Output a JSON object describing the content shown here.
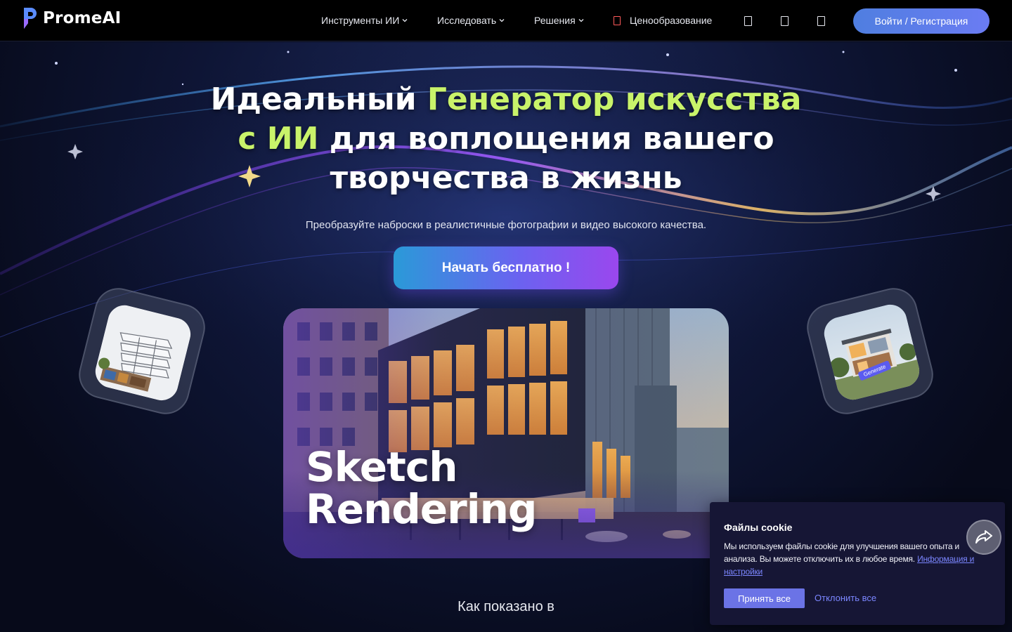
{
  "header": {
    "logo_text": "PromeAI",
    "nav": [
      {
        "label": "Инструменты ИИ"
      },
      {
        "label": "Исследовать"
      },
      {
        "label": "Решения"
      },
      {
        "label": "Ценообразование"
      }
    ],
    "icons": [
      "square-icon",
      "square-icon",
      "square-icon"
    ],
    "login_label": "Войти / Регистрация"
  },
  "hero": {
    "headline_part1": "Идеальный ",
    "headline_accent1": "Генератор искусства",
    "headline_accent2": "с ИИ",
    "headline_part2": " для воплощения вашего",
    "headline_part3": "творчества в жизнь",
    "subtitle": "Преобразуйте наброски в реалистичные фотографии и видео высокого качества.",
    "cta_label": "Начать бесплатно !",
    "main_caption_line1": "Sketch",
    "main_caption_line2": "Rendering",
    "tile_right_badge": "Generate",
    "as_seen": "Как показано в"
  },
  "cookie": {
    "title": "Файлы cookie",
    "text": "Мы используем файлы cookie для улучшения вашего опыта и анализа. Вы можете отключить их в любое время. ",
    "link": "Информация и настройки",
    "accept": "Принять все",
    "decline": "Отклонить все"
  },
  "colors": {
    "accent_green": "#c9f36a",
    "login_button": "#5b7ee8",
    "cookie_bg": "#161635",
    "link": "#7b86ff"
  }
}
